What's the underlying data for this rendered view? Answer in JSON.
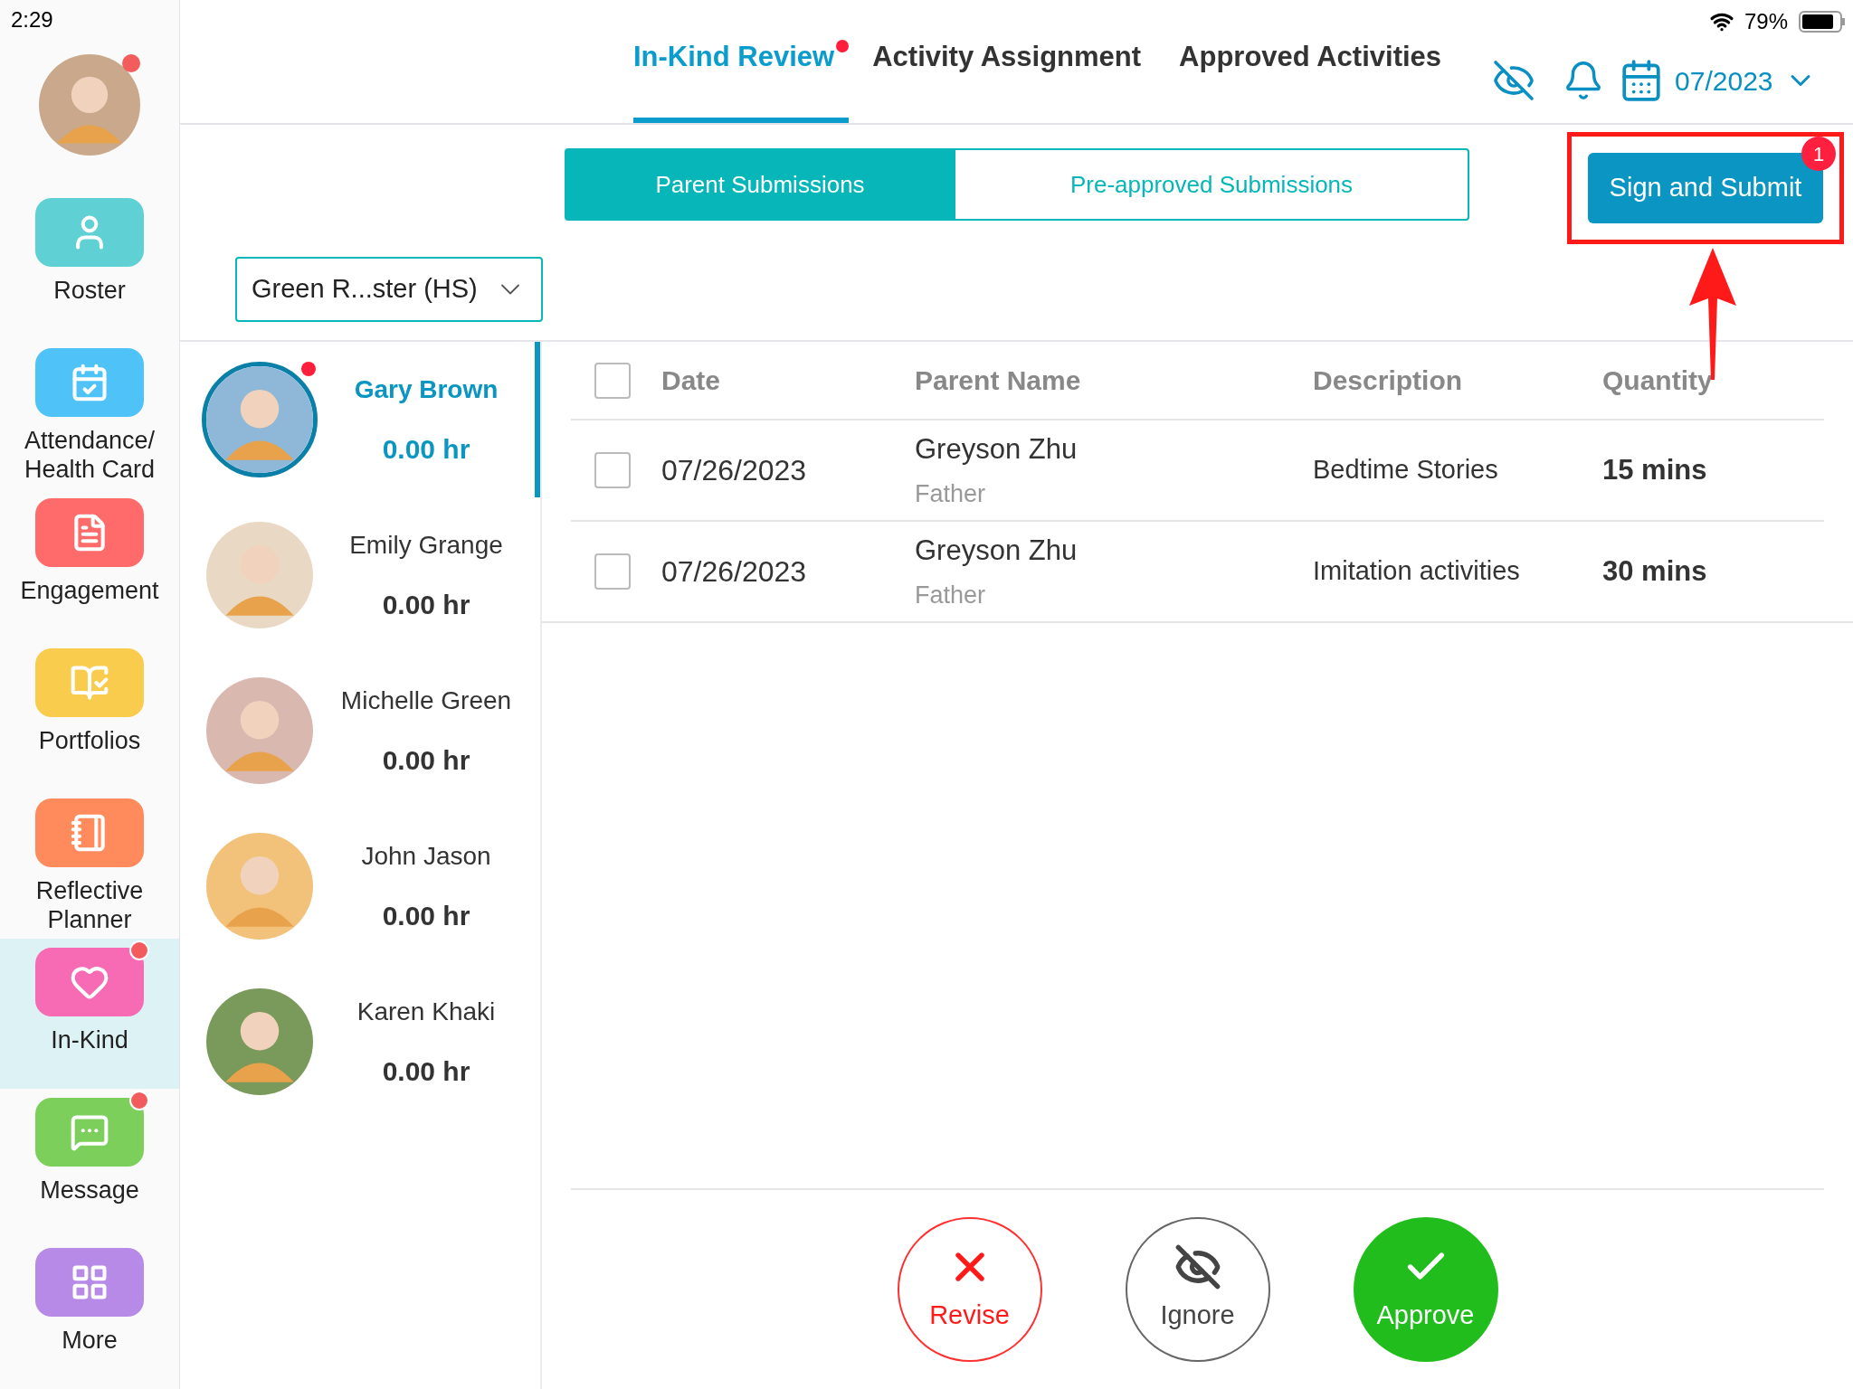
{
  "status_bar": {
    "time": "2:29",
    "battery": "79%"
  },
  "sidebar": {
    "user": {
      "unread": true
    },
    "items": [
      {
        "label": "Roster",
        "color": "#5fd0d3",
        "selected": false,
        "badge": false
      },
      {
        "label": "Attendance/ Health Card",
        "color": "#4fc3f7",
        "selected": false,
        "badge": false
      },
      {
        "label": "Engagement",
        "color": "#ff6b6b",
        "selected": false,
        "badge": false
      },
      {
        "label": "Portfolios",
        "color": "#f9cc4e",
        "selected": false,
        "badge": false
      },
      {
        "label": "Reflective Planner",
        "color": "#ff8a5c",
        "selected": false,
        "badge": false
      },
      {
        "label": "In-Kind",
        "color": "#f76bb4",
        "selected": true,
        "badge": true
      },
      {
        "label": "Message",
        "color": "#7ccf5a",
        "selected": false,
        "badge": true
      },
      {
        "label": "More",
        "color": "#b78ae8",
        "selected": false,
        "badge": false
      }
    ]
  },
  "tabs": [
    {
      "label": "In-Kind Review",
      "selected": true,
      "dot": true
    },
    {
      "label": "Activity Assignment",
      "selected": false,
      "dot": false
    },
    {
      "label": "Approved Activities",
      "selected": false,
      "dot": false
    }
  ],
  "month": "07/2023",
  "segments": [
    {
      "label": "Parent Submissions",
      "selected": true
    },
    {
      "label": "Pre-approved Submissions",
      "selected": false
    }
  ],
  "sign_button": {
    "label": "Sign and Submit",
    "badge": "1"
  },
  "class_select": {
    "value": "Green R...ster (HS)"
  },
  "students": [
    {
      "name": "Gary Brown",
      "hours": "0.00 hr",
      "selected": true,
      "dot": true
    },
    {
      "name": "Emily Grange",
      "hours": "0.00 hr",
      "selected": false,
      "dot": false
    },
    {
      "name": "Michelle Green",
      "hours": "0.00 hr",
      "selected": false,
      "dot": false
    },
    {
      "name": "John Jason",
      "hours": "0.00 hr",
      "selected": false,
      "dot": false
    },
    {
      "name": "Karen Khaki",
      "hours": "0.00 hr",
      "selected": false,
      "dot": false
    }
  ],
  "table": {
    "columns": [
      "Date",
      "Parent Name",
      "Description",
      "Quantity"
    ],
    "header_checked": false,
    "rows": [
      {
        "checked": false,
        "date": "07/26/2023",
        "parent": "Greyson Zhu",
        "relation": "Father",
        "description": "Bedtime Stories",
        "quantity": "15 mins"
      },
      {
        "checked": false,
        "date": "07/26/2023",
        "parent": "Greyson Zhu",
        "relation": "Father",
        "description": "Imitation activities",
        "quantity": "30 mins"
      }
    ]
  },
  "actions": [
    {
      "kind": "revise",
      "label": "Revise"
    },
    {
      "kind": "ignore",
      "label": "Ignore"
    },
    {
      "kind": "approve",
      "label": "Approve"
    }
  ]
}
